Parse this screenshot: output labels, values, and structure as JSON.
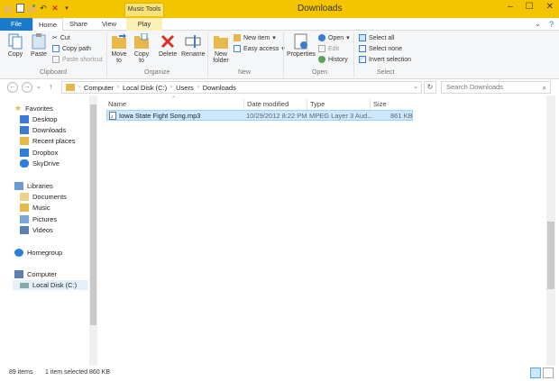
{
  "window": {
    "title": "Downloads",
    "contextual_tab": "Music Tools"
  },
  "quick_access": [
    "folder-icon",
    "properties-icon",
    "new-folder-icon",
    "undo-icon",
    "delete-icon",
    "customize-icon"
  ],
  "tabs": {
    "file": "File",
    "home": "Home",
    "share": "Share",
    "view": "View",
    "play": "Play"
  },
  "ribbon": {
    "clipboard": {
      "copy": "Copy",
      "paste": "Paste",
      "cut": "Cut",
      "copy_path": "Copy path",
      "paste_shortcut": "Paste shortcut",
      "label": "Clipboard"
    },
    "organize": {
      "move_to": "Move to",
      "copy_to": "Copy to",
      "delete": "Delete",
      "rename": "Rename",
      "label": "Organize"
    },
    "new": {
      "new_folder": "New folder",
      "new_item": "New item",
      "easy_access": "Easy access",
      "label": "New"
    },
    "open": {
      "properties": "Properties",
      "open": "Open",
      "edit": "Edit",
      "history": "History",
      "label": "Open"
    },
    "select": {
      "select_all": "Select all",
      "select_none": "Select none",
      "invert": "Invert selection",
      "label": "Select"
    }
  },
  "address": {
    "crumbs": [
      "Computer",
      "Local Disk (C:)",
      "Users",
      "Downloads"
    ],
    "search_placeholder": "Search Downloads"
  },
  "nav": {
    "favorites": "Favorites",
    "fav_items": [
      "Desktop",
      "Downloads",
      "Recent places",
      "Dropbox",
      "SkyDrive"
    ],
    "libraries": "Libraries",
    "lib_items": [
      "Documents",
      "Music",
      "Pictures",
      "Videos"
    ],
    "homegroup": "Homegroup",
    "computer": "Computer",
    "comp_items": [
      "Local Disk (C:)"
    ]
  },
  "columns": {
    "name": "Name",
    "date": "Date modified",
    "type": "Type",
    "size": "Size"
  },
  "files": [
    {
      "name": "Iowa State Fight Song.mp3",
      "date": "10/29/2012 8:22 PM",
      "type": "MPEG Layer 3 Aud...",
      "size": "861 KB"
    }
  ],
  "status": {
    "items": "89 items",
    "selected": "1 item selected  860 KB"
  },
  "colors": {
    "accent": "#1979ca",
    "titlebar": "#f4c400",
    "selection": "#cce8ff"
  }
}
